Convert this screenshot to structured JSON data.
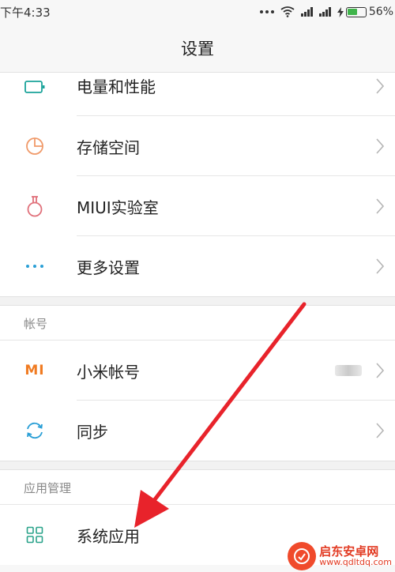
{
  "status_bar": {
    "time": "下午4:33",
    "battery_percent": "56%",
    "battery_level": 0.56,
    "battery_color": "#3fb44a"
  },
  "header": {
    "title": "设置"
  },
  "groups": [
    {
      "items": [
        {
          "label": "电量和性能",
          "icon": "battery-icon",
          "icon_color": "#1aa39a"
        },
        {
          "label": "存储空间",
          "icon": "pie-chart-icon",
          "icon_color": "#f09a6a"
        },
        {
          "label": "MIUI实验室",
          "icon": "flask-icon",
          "icon_color": "#e0707a"
        },
        {
          "label": "更多设置",
          "icon": "more-dots-icon",
          "icon_color": "#2a9fd6"
        }
      ]
    },
    {
      "section_title": "帐号",
      "items": [
        {
          "label": "小米帐号",
          "icon": "mi-logo-icon",
          "icon_color": "#f07b22",
          "icon_text": "MI"
        },
        {
          "label": "同步",
          "icon": "sync-icon",
          "icon_color": "#2a9fd6"
        }
      ]
    },
    {
      "section_title": "应用管理",
      "items": [
        {
          "label": "系统应用",
          "icon": "apps-grid-icon",
          "icon_color": "#2aa38a"
        }
      ]
    }
  ],
  "annotation": {
    "arrow_color": "#e8232b"
  },
  "watermark": {
    "line1": "启东安卓网",
    "line2": "www.qdltdq.com"
  }
}
